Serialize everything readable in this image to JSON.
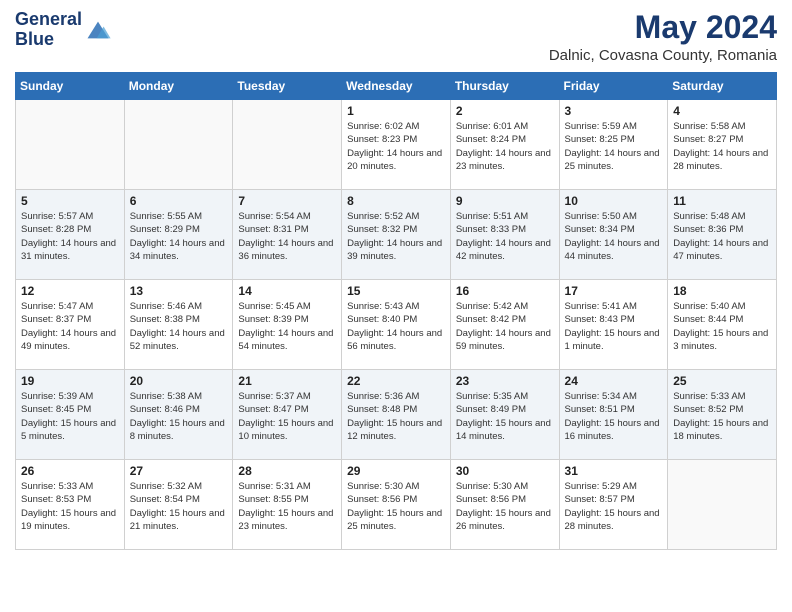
{
  "header": {
    "logo_line1": "General",
    "logo_line2": "Blue",
    "month": "May 2024",
    "location": "Dalnic, Covasna County, Romania"
  },
  "days_of_week": [
    "Sunday",
    "Monday",
    "Tuesday",
    "Wednesday",
    "Thursday",
    "Friday",
    "Saturday"
  ],
  "weeks": [
    [
      {
        "day": "",
        "sunrise": "",
        "sunset": "",
        "daylight": ""
      },
      {
        "day": "",
        "sunrise": "",
        "sunset": "",
        "daylight": ""
      },
      {
        "day": "",
        "sunrise": "",
        "sunset": "",
        "daylight": ""
      },
      {
        "day": "1",
        "sunrise": "Sunrise: 6:02 AM",
        "sunset": "Sunset: 8:23 PM",
        "daylight": "Daylight: 14 hours and 20 minutes."
      },
      {
        "day": "2",
        "sunrise": "Sunrise: 6:01 AM",
        "sunset": "Sunset: 8:24 PM",
        "daylight": "Daylight: 14 hours and 23 minutes."
      },
      {
        "day": "3",
        "sunrise": "Sunrise: 5:59 AM",
        "sunset": "Sunset: 8:25 PM",
        "daylight": "Daylight: 14 hours and 25 minutes."
      },
      {
        "day": "4",
        "sunrise": "Sunrise: 5:58 AM",
        "sunset": "Sunset: 8:27 PM",
        "daylight": "Daylight: 14 hours and 28 minutes."
      }
    ],
    [
      {
        "day": "5",
        "sunrise": "Sunrise: 5:57 AM",
        "sunset": "Sunset: 8:28 PM",
        "daylight": "Daylight: 14 hours and 31 minutes."
      },
      {
        "day": "6",
        "sunrise": "Sunrise: 5:55 AM",
        "sunset": "Sunset: 8:29 PM",
        "daylight": "Daylight: 14 hours and 34 minutes."
      },
      {
        "day": "7",
        "sunrise": "Sunrise: 5:54 AM",
        "sunset": "Sunset: 8:31 PM",
        "daylight": "Daylight: 14 hours and 36 minutes."
      },
      {
        "day": "8",
        "sunrise": "Sunrise: 5:52 AM",
        "sunset": "Sunset: 8:32 PM",
        "daylight": "Daylight: 14 hours and 39 minutes."
      },
      {
        "day": "9",
        "sunrise": "Sunrise: 5:51 AM",
        "sunset": "Sunset: 8:33 PM",
        "daylight": "Daylight: 14 hours and 42 minutes."
      },
      {
        "day": "10",
        "sunrise": "Sunrise: 5:50 AM",
        "sunset": "Sunset: 8:34 PM",
        "daylight": "Daylight: 14 hours and 44 minutes."
      },
      {
        "day": "11",
        "sunrise": "Sunrise: 5:48 AM",
        "sunset": "Sunset: 8:36 PM",
        "daylight": "Daylight: 14 hours and 47 minutes."
      }
    ],
    [
      {
        "day": "12",
        "sunrise": "Sunrise: 5:47 AM",
        "sunset": "Sunset: 8:37 PM",
        "daylight": "Daylight: 14 hours and 49 minutes."
      },
      {
        "day": "13",
        "sunrise": "Sunrise: 5:46 AM",
        "sunset": "Sunset: 8:38 PM",
        "daylight": "Daylight: 14 hours and 52 minutes."
      },
      {
        "day": "14",
        "sunrise": "Sunrise: 5:45 AM",
        "sunset": "Sunset: 8:39 PM",
        "daylight": "Daylight: 14 hours and 54 minutes."
      },
      {
        "day": "15",
        "sunrise": "Sunrise: 5:43 AM",
        "sunset": "Sunset: 8:40 PM",
        "daylight": "Daylight: 14 hours and 56 minutes."
      },
      {
        "day": "16",
        "sunrise": "Sunrise: 5:42 AM",
        "sunset": "Sunset: 8:42 PM",
        "daylight": "Daylight: 14 hours and 59 minutes."
      },
      {
        "day": "17",
        "sunrise": "Sunrise: 5:41 AM",
        "sunset": "Sunset: 8:43 PM",
        "daylight": "Daylight: 15 hours and 1 minute."
      },
      {
        "day": "18",
        "sunrise": "Sunrise: 5:40 AM",
        "sunset": "Sunset: 8:44 PM",
        "daylight": "Daylight: 15 hours and 3 minutes."
      }
    ],
    [
      {
        "day": "19",
        "sunrise": "Sunrise: 5:39 AM",
        "sunset": "Sunset: 8:45 PM",
        "daylight": "Daylight: 15 hours and 5 minutes."
      },
      {
        "day": "20",
        "sunrise": "Sunrise: 5:38 AM",
        "sunset": "Sunset: 8:46 PM",
        "daylight": "Daylight: 15 hours and 8 minutes."
      },
      {
        "day": "21",
        "sunrise": "Sunrise: 5:37 AM",
        "sunset": "Sunset: 8:47 PM",
        "daylight": "Daylight: 15 hours and 10 minutes."
      },
      {
        "day": "22",
        "sunrise": "Sunrise: 5:36 AM",
        "sunset": "Sunset: 8:48 PM",
        "daylight": "Daylight: 15 hours and 12 minutes."
      },
      {
        "day": "23",
        "sunrise": "Sunrise: 5:35 AM",
        "sunset": "Sunset: 8:49 PM",
        "daylight": "Daylight: 15 hours and 14 minutes."
      },
      {
        "day": "24",
        "sunrise": "Sunrise: 5:34 AM",
        "sunset": "Sunset: 8:51 PM",
        "daylight": "Daylight: 15 hours and 16 minutes."
      },
      {
        "day": "25",
        "sunrise": "Sunrise: 5:33 AM",
        "sunset": "Sunset: 8:52 PM",
        "daylight": "Daylight: 15 hours and 18 minutes."
      }
    ],
    [
      {
        "day": "26",
        "sunrise": "Sunrise: 5:33 AM",
        "sunset": "Sunset: 8:53 PM",
        "daylight": "Daylight: 15 hours and 19 minutes."
      },
      {
        "day": "27",
        "sunrise": "Sunrise: 5:32 AM",
        "sunset": "Sunset: 8:54 PM",
        "daylight": "Daylight: 15 hours and 21 minutes."
      },
      {
        "day": "28",
        "sunrise": "Sunrise: 5:31 AM",
        "sunset": "Sunset: 8:55 PM",
        "daylight": "Daylight: 15 hours and 23 minutes."
      },
      {
        "day": "29",
        "sunrise": "Sunrise: 5:30 AM",
        "sunset": "Sunset: 8:56 PM",
        "daylight": "Daylight: 15 hours and 25 minutes."
      },
      {
        "day": "30",
        "sunrise": "Sunrise: 5:30 AM",
        "sunset": "Sunset: 8:56 PM",
        "daylight": "Daylight: 15 hours and 26 minutes."
      },
      {
        "day": "31",
        "sunrise": "Sunrise: 5:29 AM",
        "sunset": "Sunset: 8:57 PM",
        "daylight": "Daylight: 15 hours and 28 minutes."
      },
      {
        "day": "",
        "sunrise": "",
        "sunset": "",
        "daylight": ""
      }
    ]
  ]
}
